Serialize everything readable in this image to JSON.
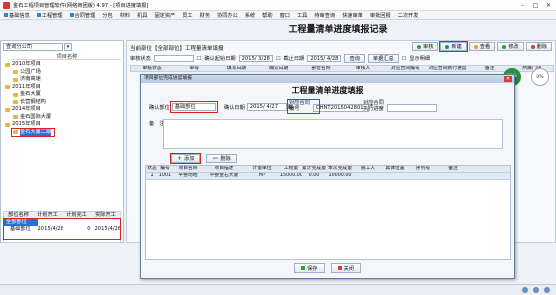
{
  "window": {
    "title": "金石工程项目管理软件(网络商团版) 4.97 - [项目进度填报]"
  },
  "menu": [
    "基础信息",
    "工程管理",
    "合同管理",
    "分包",
    "材料",
    "机具",
    "固定资产",
    "员工",
    "财务",
    "协同办公",
    "系统",
    "帮助",
    "窗口",
    "工具",
    "待审查询",
    "快速审单",
    "审批回报",
    "二次开发"
  ],
  "page_title": "工程量清单进度填报记录",
  "left_panel": {
    "search_placeholder": "查询分公司",
    "column_header": "项目名称",
    "tree": [
      {
        "label": "2010年项目",
        "level": 1
      },
      {
        "label": "公园广场",
        "level": 2
      },
      {
        "label": "济南高速",
        "level": 2
      },
      {
        "label": "2011年项目",
        "level": 1
      },
      {
        "label": "金石大厦",
        "level": 2
      },
      {
        "label": "长营钢结构",
        "level": 2
      },
      {
        "label": "2014年项目",
        "level": 1
      },
      {
        "label": "金石国际大厦",
        "level": 2
      },
      {
        "label": "2015年项目",
        "level": 1
      },
      {
        "label": "金石大厦二期",
        "level": 2,
        "selected": true
      }
    ],
    "bottom_headers": [
      "部位名称",
      "计划开工",
      "计划完工",
      "实际开工"
    ],
    "bottom_rows": [
      [
        "全部部位",
        "",
        "",
        ""
      ],
      [
        "基础部位",
        "2015/4/28",
        "0",
        "2015/4/28"
      ]
    ]
  },
  "main": {
    "breadcrumb": "当前部位【全部部位】工程量清单填报",
    "toolbar": [
      "审核",
      "新建",
      "查看",
      "修改",
      "删除"
    ],
    "filter": {
      "status_label": "审核状态",
      "status_value": "",
      "date_check": "确认起始日期",
      "date_from": "2015/ 3/28",
      "end_check": "截止日期",
      "date_to": "2015/ 4/28",
      "query": "查询",
      "summary": "单据汇总",
      "show_detail": "显示明细"
    },
    "grid_headers": [
      "审核状态",
      "单号",
      "填写日期",
      "确认日期",
      "部位名称",
      "审核人",
      "对应合同编号",
      "对应合同执行进度",
      "备注",
      "所属门店"
    ],
    "percent_a": "39%",
    "percent_b": "0%"
  },
  "dialog": {
    "title": "项目部位完成进度填报",
    "heading": "工程量清单进度填报",
    "part_label": "确认部位",
    "part_value": "基础部位",
    "date_label": "确认日期",
    "date_value": "2015/ 4/27",
    "contract_label": "对应合同编号",
    "contract_value": "CHNT2015042801",
    "progress_label": "对应合同执行进度",
    "progress_value": "",
    "note_label": "备　注",
    "add_label": "添加",
    "delete_label": "删除",
    "grid_headers": [
      "状态",
      "编号",
      "项目名称",
      "项目描述",
      "计量单位",
      "工程量",
      "累计完成量",
      "本次完成量",
      "施工人",
      "具体位置",
      "序列号",
      "备注",
      ""
    ],
    "grid_rows": [
      [
        "1",
        "1001",
        "平整场地",
        "平整金石大厦",
        "m²",
        "15000.00",
        "0.00",
        "10000.00",
        "",
        "",
        "",
        "",
        ""
      ]
    ],
    "save_label": "保存",
    "close_label": "关闭"
  }
}
